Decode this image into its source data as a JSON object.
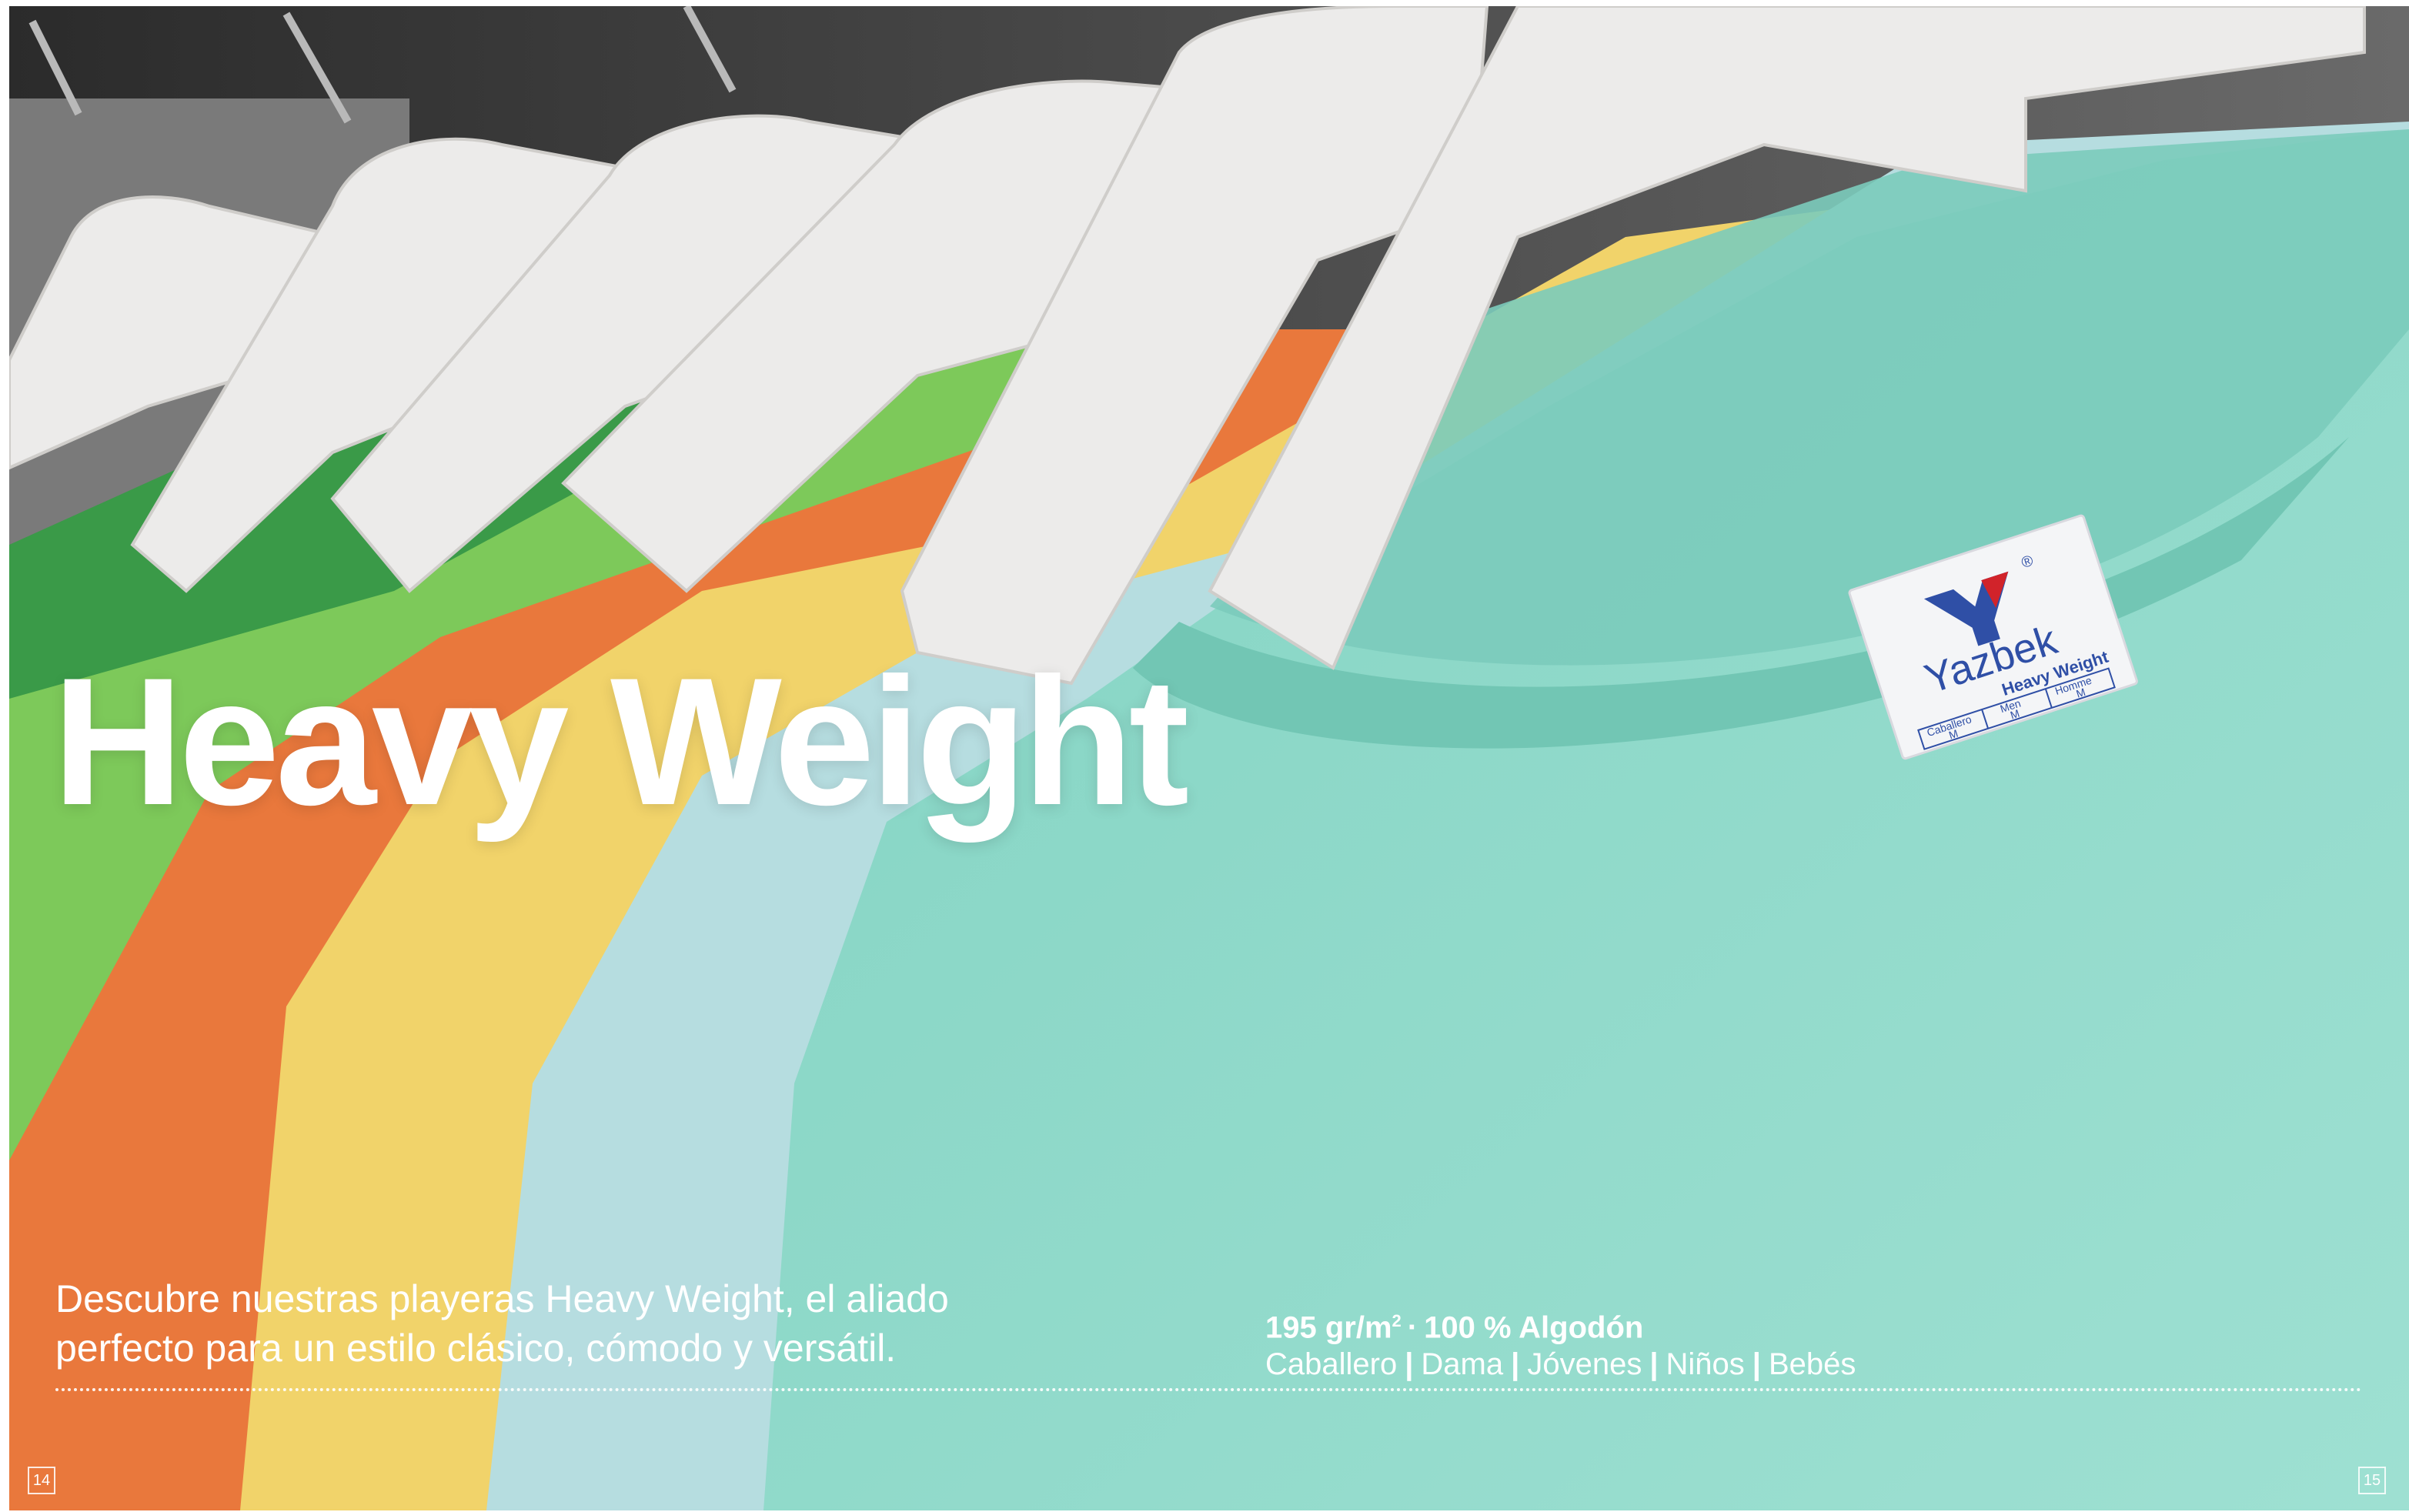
{
  "heading": "Heavy Weight",
  "intro": "Descubre nuestras playeras Heavy Weight, el aliado perfecto para un estilo clásico, cómodo y versátil.",
  "specs": {
    "weight": "195 gr/m",
    "weight_exp": "2",
    "separator": "·",
    "material": "100 % Algodón",
    "categories": [
      "Caballero",
      "Dama",
      "Jóvenes",
      "Niños",
      "Bebés"
    ],
    "category_separator": "|"
  },
  "label": {
    "brand": "Yazbek",
    "registered": "®",
    "line": "Heavy Weight",
    "sizes": [
      {
        "name": "Caballero",
        "size": "M"
      },
      {
        "name": "Men",
        "size": "M"
      },
      {
        "name": "Homme",
        "size": "M"
      }
    ]
  },
  "page_numbers": {
    "left": "14",
    "right": "15"
  },
  "colors": {
    "text": "#ffffff",
    "brand_blue": "#2f4fa6",
    "brand_red": "#d1232a",
    "shirts": [
      "#8fd8c8",
      "#b6dde0",
      "#f1d36a",
      "#e9783c",
      "#7dc95a",
      "#3a9a48",
      "#4a4a4a"
    ]
  }
}
